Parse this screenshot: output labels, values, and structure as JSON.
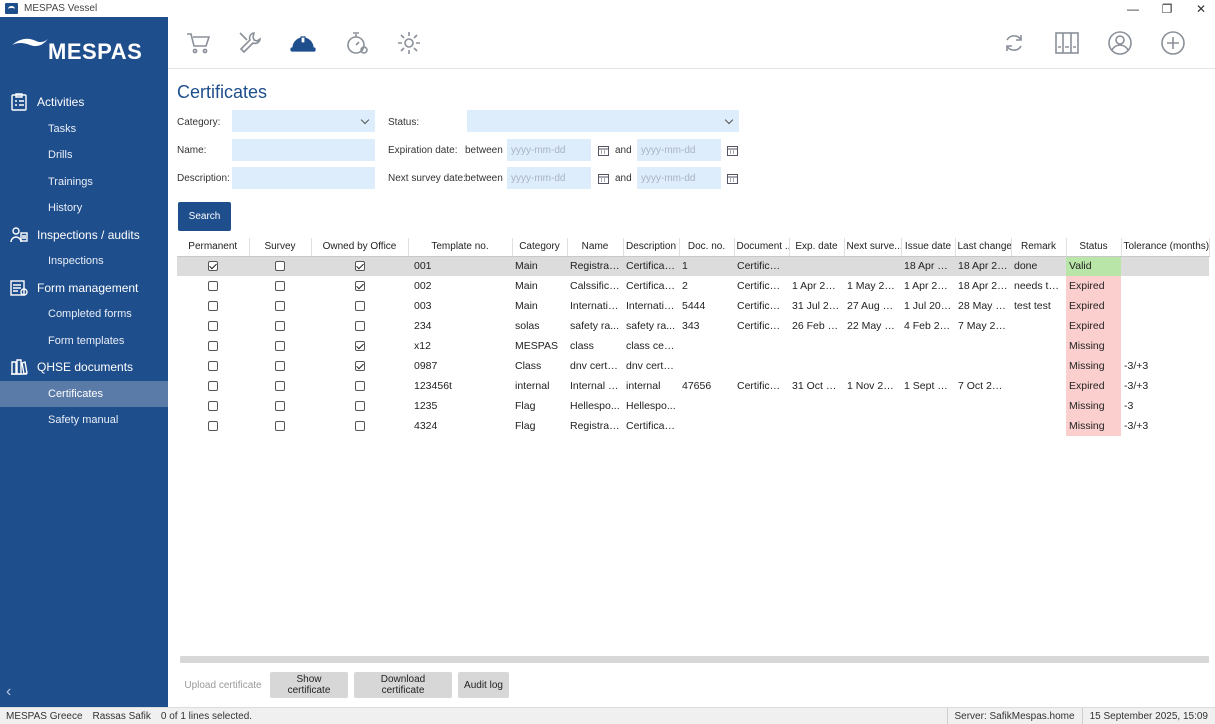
{
  "window": {
    "title": "MESPAS Vessel",
    "minimize": "—",
    "restore": "❐",
    "close": "✕"
  },
  "brand": {
    "logo_text": "MESPAS"
  },
  "sidebar": {
    "sections": [
      {
        "label": "Activities",
        "icon": "clipboard-icon",
        "items": [
          "Tasks",
          "Drills",
          "Trainings",
          "History"
        ]
      },
      {
        "label": "Inspections / audits",
        "icon": "inspector-icon",
        "items": [
          "Inspections"
        ]
      },
      {
        "label": "Form management",
        "icon": "form-icon",
        "items": [
          "Completed forms",
          "Form templates"
        ]
      },
      {
        "label": "QHSE documents",
        "icon": "books-icon",
        "items": [
          "Certificates",
          "Safety manual"
        ]
      }
    ],
    "active_item": "Certificates",
    "collapse_glyph": "‹"
  },
  "toolbar": {
    "left_icons": [
      "cart-icon",
      "wrench-icon",
      "hardhat-icon",
      "stopwatch-gear-icon",
      "gear-icon"
    ],
    "right_icons": [
      "refresh-icon",
      "binders-icon",
      "user-icon",
      "add-icon"
    ]
  },
  "page": {
    "title": "Certificates"
  },
  "filters": {
    "category_label": "Category:",
    "status_label": "Status:",
    "name_label": "Name:",
    "description_label": "Description:",
    "expiration_label": "Expiration date:",
    "next_survey_label": "Next survey date:",
    "between": "between",
    "and": "and",
    "date_placeholder": "yyyy-mm-dd",
    "search_button": "Search"
  },
  "table": {
    "columns": [
      "Permanent",
      "Survey",
      "Owned by Office",
      "Template no.",
      "Category",
      "Name",
      "Description",
      "Doc. no.",
      "Document ...",
      "Exp. date",
      "Next surve...",
      "Issue date",
      "Last change",
      "Remark",
      "Status",
      "Tolerance (months)"
    ],
    "rows": [
      {
        "permanent": true,
        "survey": false,
        "office": true,
        "template": "001",
        "category": "Main",
        "name": "Registrati...",
        "description": "Certificat...",
        "doc_no": "1",
        "document": "Certificat...",
        "exp_date": "",
        "next_survey": "",
        "issue_date": "18 Apr 20...",
        "last_change": "18 Apr 20...",
        "remark": "done",
        "status": "Valid",
        "tolerance": ""
      },
      {
        "permanent": false,
        "survey": false,
        "office": true,
        "template": "002",
        "category": "Main",
        "name": "Calssificat...",
        "description": "Certificat...",
        "doc_no": "2",
        "document": "Certificat...",
        "exp_date": "1 Apr 2024",
        "next_survey": "1 May 20...",
        "issue_date": "1 Apr 2024",
        "last_change": "18 Apr 20...",
        "remark": "needs to ...",
        "status": "Expired",
        "tolerance": ""
      },
      {
        "permanent": false,
        "survey": false,
        "office": false,
        "template": "003",
        "category": "Main",
        "name": "Internatio...",
        "description": "Internatio...",
        "doc_no": "5444",
        "document": "Certificat...",
        "exp_date": "31 Jul 2025",
        "next_survey": "27 Aug 20...",
        "issue_date": "1 Jul 2024",
        "last_change": "28 May 2...",
        "remark": "test test",
        "status": "Expired",
        "tolerance": ""
      },
      {
        "permanent": false,
        "survey": false,
        "office": false,
        "template": "234",
        "category": "solas",
        "name": "safety ra...",
        "description": "safety ra...",
        "doc_no": "343",
        "document": "Certificat...",
        "exp_date": "26 Feb 20...",
        "next_survey": "22 May 2...",
        "issue_date": "4 Feb 2025",
        "last_change": "7 May 20...",
        "remark": "",
        "status": "Expired",
        "tolerance": ""
      },
      {
        "permanent": false,
        "survey": false,
        "office": true,
        "template": "x12",
        "category": "MESPAS",
        "name": "class",
        "description": "class certi...",
        "doc_no": "",
        "document": "",
        "exp_date": "",
        "next_survey": "",
        "issue_date": "",
        "last_change": "",
        "remark": "",
        "status": "Missing",
        "tolerance": ""
      },
      {
        "permanent": false,
        "survey": false,
        "office": true,
        "template": "0987",
        "category": "Class",
        "name": "dnv certifi...",
        "description": "dnv certifi...",
        "doc_no": "",
        "document": "",
        "exp_date": "",
        "next_survey": "",
        "issue_date": "",
        "last_change": "",
        "remark": "",
        "status": "Missing",
        "tolerance": "-3/+3"
      },
      {
        "permanent": false,
        "survey": false,
        "office": false,
        "template": "123456t",
        "category": "internal",
        "name": "Internal c...",
        "description": "internal",
        "doc_no": "47656",
        "document": "Certificat...",
        "exp_date": "31 Oct 20...",
        "next_survey": "1 Nov 2024",
        "issue_date": "1 Sept 20...",
        "last_change": "7 Oct 2024",
        "remark": "",
        "status": "Expired",
        "tolerance": "-3/+3"
      },
      {
        "permanent": false,
        "survey": false,
        "office": false,
        "template": "1235",
        "category": "Flag",
        "name": "Hellespo...",
        "description": "Hellespo...",
        "doc_no": "",
        "document": "",
        "exp_date": "",
        "next_survey": "",
        "issue_date": "",
        "last_change": "",
        "remark": "",
        "status": "Missing",
        "tolerance": "-3"
      },
      {
        "permanent": false,
        "survey": false,
        "office": false,
        "template": "4324",
        "category": "Flag",
        "name": "Registrati...",
        "description": "Certificat...",
        "doc_no": "",
        "document": "",
        "exp_date": "",
        "next_survey": "",
        "issue_date": "",
        "last_change": "",
        "remark": "",
        "status": "Missing",
        "tolerance": "-3/+3"
      }
    ],
    "selected_row": 0
  },
  "actions": {
    "upload": "Upload certificate",
    "show": "Show certificate",
    "download": "Download certificate",
    "audit": "Audit log"
  },
  "statusbar": {
    "company": "MESPAS Greece",
    "user": "Rassas Safik",
    "selection": "0 of 1 lines selected.",
    "server": "Server: SafikMespas.home",
    "datetime": "15 September 2025, 15:09"
  },
  "colors": {
    "brand": "#1f4e8c",
    "valid": "#b9e6a8",
    "expired": "#fccfcf",
    "input": "#deedfb"
  }
}
